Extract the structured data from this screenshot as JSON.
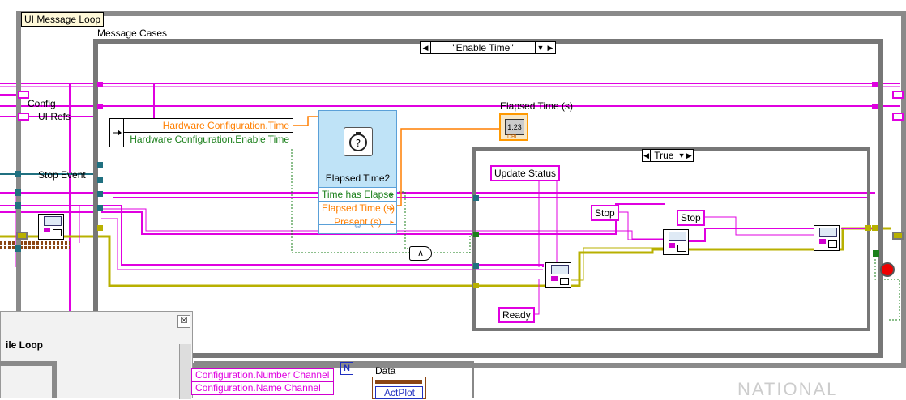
{
  "loop": {
    "label": "UI Message Loop"
  },
  "case_structure": {
    "label": "Message Cases",
    "selector": "\"Enable Time\""
  },
  "inner_case": {
    "selector": "True"
  },
  "left_terminals": {
    "config": "Config",
    "ui_refs": "UI Refs",
    "stop_event": "Stop Event"
  },
  "unbundle": {
    "row1": "Hardware Configuration.Time",
    "row2": "Hardware Configuration.Enable Time"
  },
  "express_vi": {
    "title": "Elapsed Time2",
    "outputs": [
      "Time has Elapse",
      "Elapsed Time (s)",
      "Present (s)"
    ]
  },
  "indicator": {
    "label": "Elapsed Time (s)",
    "value": "1.23",
    "type": "DBL"
  },
  "strings": {
    "update_status": "Update Status",
    "stop1": "Stop",
    "stop2": "Stop",
    "ready": "Ready"
  },
  "and_gate": "∧",
  "overlay_window": {
    "title": "ile Loop",
    "close": "☒"
  },
  "lower_bundle": {
    "row1": "Configuration.Number Channel",
    "row2": "Configuration.Name Channel"
  },
  "lower": {
    "n": "N",
    "data_label": "Data",
    "act_plot": "ActPlot"
  },
  "watermark": "NATIONAL",
  "colors": {
    "cluster_wire": "#e000e0",
    "bool_wire": "#1a7f1a",
    "dbl_wire": "#ff7f00",
    "error_wire": "#b8b000",
    "ref_wire": "#207080"
  }
}
